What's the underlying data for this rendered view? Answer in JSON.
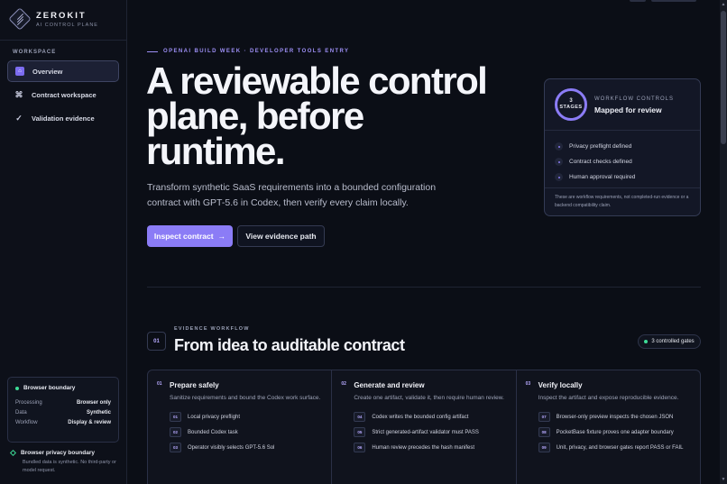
{
  "brand": {
    "name": "ZEROKIT",
    "subtitle": "AI CONTROL PLANE"
  },
  "sidebar": {
    "section_label": "WORKSPACE",
    "items": [
      {
        "label": "Overview",
        "icon": "home-icon",
        "active": true
      },
      {
        "label": "Contract workspace",
        "icon": "command-icon",
        "active": false
      },
      {
        "label": "Validation evidence",
        "icon": "check-icon",
        "active": false
      }
    ],
    "boundary_card": {
      "title": "Browser boundary",
      "rows": [
        {
          "key": "Processing",
          "value": "Browser only"
        },
        {
          "key": "Data",
          "value": "Synthetic"
        },
        {
          "key": "Workflow",
          "value": "Display & review"
        }
      ]
    },
    "privacy": {
      "title": "Browser privacy boundary",
      "text": "Bundled data is synthetic. No third-party or model request."
    }
  },
  "hero": {
    "eyebrow": "OPENAI BUILD WEEK · DEVELOPER TOOLS ENTRY",
    "title": "A reviewable control plane, before runtime.",
    "description": "Transform synthetic SaaS requirements into a bounded configuration contract with GPT-5.6 in Codex, then verify every claim locally.",
    "primary_button": "Inspect contract",
    "primary_arrow": "→",
    "secondary_button": "View evidence path"
  },
  "controls_card": {
    "ring_number": "3",
    "ring_label": "STAGES",
    "eyebrow": "WORKFLOW CONTROLS",
    "title": "Mapped for review",
    "items": [
      "Privacy preflight defined",
      "Contract checks defined",
      "Human approval required"
    ],
    "note": "These are workflow requirements, not completed-run evidence or a backend compatibility claim."
  },
  "workflow": {
    "number": "01",
    "eyebrow": "EVIDENCE WORKFLOW",
    "title": "From idea to auditable contract",
    "gates": "3 controlled gates",
    "stages": [
      {
        "num": "01",
        "title": "Prepare safely",
        "desc": "Sanitize requirements and bound the Codex work surface.",
        "steps": [
          {
            "n": "01",
            "text": "Local privacy preflight"
          },
          {
            "n": "02",
            "text": "Bounded Codex task"
          },
          {
            "n": "03",
            "text": "Operator visibly selects GPT-5.6 Sol"
          }
        ]
      },
      {
        "num": "02",
        "title": "Generate and review",
        "desc": "Create one artifact, validate it, then require human review.",
        "steps": [
          {
            "n": "04",
            "text": "Codex writes the bounded config artifact"
          },
          {
            "n": "05",
            "text": "Strict generated-artifact validator must PASS"
          },
          {
            "n": "06",
            "text": "Human review precedes the hash manifest"
          }
        ]
      },
      {
        "num": "03",
        "title": "Verify locally",
        "desc": "Inspect the artifact and expose reproducible evidence.",
        "steps": [
          {
            "n": "07",
            "text": "Browser-only preview inspects the chosen JSON"
          },
          {
            "n": "08",
            "text": "PocketBase fixture proves one adapter boundary"
          },
          {
            "n": "09",
            "text": "Unit, privacy, and browser gates report PASS or FAIL"
          }
        ]
      }
    ]
  },
  "colors": {
    "accent": "#8b7cf6",
    "background": "#0b0e16",
    "success": "#3ddc97"
  }
}
